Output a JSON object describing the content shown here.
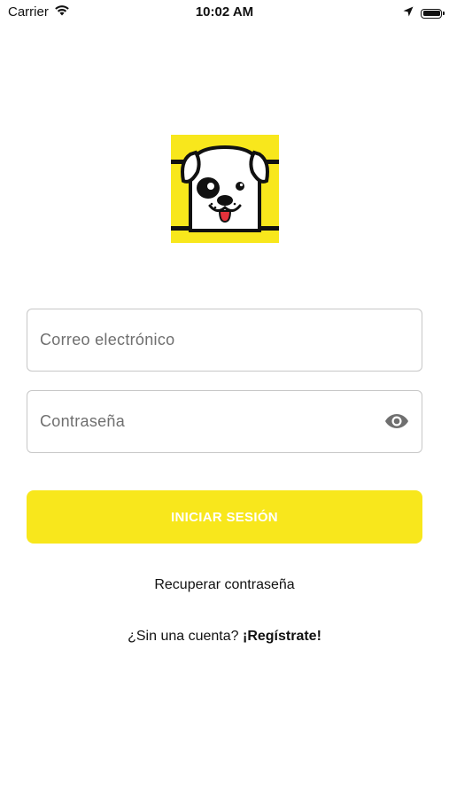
{
  "status_bar": {
    "carrier": "Carrier",
    "time": "10:02 AM"
  },
  "icons": {
    "logo": "dog-logo",
    "wifi": "wifi-icon",
    "location": "location-arrow-icon",
    "battery": "battery-icon",
    "visibility": "eye-icon"
  },
  "form": {
    "email_placeholder": "Correo electrónico",
    "email_value": "",
    "password_placeholder": "Contraseña",
    "password_value": "",
    "login_label": "INICIAR SESIÓN",
    "recover_label": "Recuperar contraseña",
    "no_account_label": "¿Sin una cuenta?",
    "register_label": "¡Regístrate!"
  },
  "colors": {
    "accent": "#F8E71C",
    "button_text": "#FFFFFF",
    "border": "#C7C7C7"
  }
}
